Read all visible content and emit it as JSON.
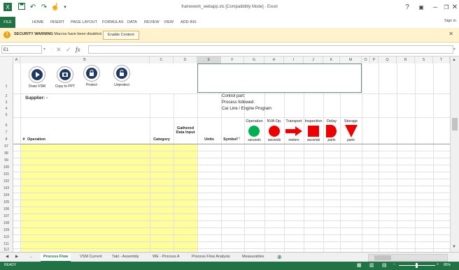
{
  "window": {
    "title": "framework_webapp.xls [Compatibility Mode] - Excel",
    "help_label": "?",
    "ribbon_display_icon": "ribbon-display-icon",
    "minimize_icon": "minimize-icon",
    "restore_icon": "restore-icon",
    "close_icon": "close-icon"
  },
  "quick_access": [
    "save-icon",
    "undo-icon",
    "redo-icon",
    "touch-mode-icon",
    "customize-icon"
  ],
  "ribbon": {
    "file_tab": "FILE",
    "tabs": [
      "HOME",
      "INSERT",
      "PAGE LAYOUT",
      "FORMULAS",
      "DATA",
      "REVIEW",
      "VIEW",
      "ADD-INS"
    ],
    "sign_in": "Sign in"
  },
  "security_bar": {
    "title": "SECURITY WARNING",
    "message": "Macros have been disabled.",
    "button": "Enable Content"
  },
  "formula_bar": {
    "name_box": "E1",
    "fx": "fx",
    "value": ""
  },
  "columns": [
    "A",
    "B",
    "C",
    "D",
    "E",
    "F",
    "G",
    "H",
    "I",
    "J",
    "K",
    "M",
    "O",
    "P",
    "Q",
    "R",
    "S",
    "T"
  ],
  "selected_column": "E",
  "rows": {
    "top": [
      "1",
      "2",
      "3",
      "4",
      "5",
      "6",
      "7",
      "8"
    ],
    "data": [
      "97",
      "98",
      "99",
      "100",
      "101",
      "102",
      "103",
      "104",
      "105",
      "106",
      "107",
      "108",
      "109",
      "110",
      "111",
      "112"
    ]
  },
  "macro_buttons": [
    {
      "label": "Draw VSM"
    },
    {
      "label": "Copy to PPT"
    },
    {
      "label": "Protect"
    },
    {
      "label": "Unprotect"
    }
  ],
  "supplier_label": "Supplier: -",
  "info_lines": [
    "Control part:",
    "Process followed:",
    "Car Line / Engine Program"
  ],
  "table_headers": {
    "num": "#",
    "operation": "Operation",
    "category": "Category",
    "gathered": "Gathered Data Input",
    "units": "Units",
    "symbol": "Symbol",
    "symbol_filter": "(*)"
  },
  "symbol_columns": [
    {
      "label": "Operation",
      "unit": "seconds",
      "color": "#00b050",
      "shape": "circle"
    },
    {
      "label": "NVA Op.",
      "unit": "seconds",
      "color": "#ee0000",
      "shape": "circle"
    },
    {
      "label": "Transport",
      "unit": "meters",
      "color": "#ee0000",
      "shape": "arrow"
    },
    {
      "label": "Inspection",
      "unit": "seconds",
      "color": "#ee0000",
      "shape": "square"
    },
    {
      "label": "Delay",
      "unit": "parts",
      "color": "#ee0000",
      "shape": "d-shape"
    },
    {
      "label": "Storage",
      "unit": "parts",
      "color": "#ee0000",
      "shape": "triangle"
    }
  ],
  "sheet_tabs": [
    "...",
    "Process Flow",
    "VSM Current",
    "Takt - Assembly",
    "WE - Process A",
    "Process Flow Analysis",
    "Measurables"
  ],
  "active_tab": "Process Flow",
  "status": {
    "ready": "READY",
    "zoom": "85%"
  }
}
